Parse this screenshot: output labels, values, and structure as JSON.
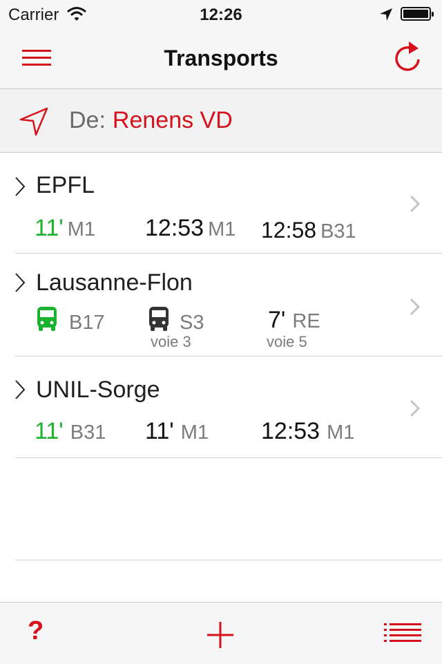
{
  "status_bar": {
    "carrier": "Carrier",
    "time": "12:26",
    "wifi_icon": "wifi-icon",
    "location_icon": "location-arrow-icon",
    "battery_icon": "battery-icon"
  },
  "nav": {
    "title": "Transports",
    "menu_icon": "hamburger-menu-icon",
    "refresh_icon": "refresh-icon"
  },
  "from": {
    "label": "De:",
    "value": "Renens VD",
    "icon": "location-arrow-icon"
  },
  "destinations": [
    {
      "name": "EPFL",
      "departures": [
        {
          "time": "11'",
          "line": "M1",
          "time_color": "green"
        },
        {
          "time": "12:53",
          "line": "M1"
        },
        {
          "time": "12:58",
          "line": "B31"
        }
      ]
    },
    {
      "name": "Lausanne-Flon",
      "departures": [
        {
          "icon": "bus-icon-green",
          "line": "B17"
        },
        {
          "icon": "bus-icon-dark",
          "line": "S3",
          "platform": "voie 3"
        },
        {
          "time": "7'",
          "line": "RE",
          "platform": "voie 5"
        }
      ]
    },
    {
      "name": "UNIL-Sorge",
      "departures": [
        {
          "time": "11'",
          "line": "B31",
          "time_color": "green"
        },
        {
          "time": "11'",
          "line": "M1"
        },
        {
          "time": "12:53",
          "line": "M1"
        }
      ]
    }
  ],
  "toolbar": {
    "help_label": "?",
    "add_icon": "plus-icon",
    "list_icon": "list-icon"
  },
  "colors": {
    "accent": "#d6111b",
    "soon": "#19b22c",
    "secondary_text": "#7b7b7b"
  }
}
